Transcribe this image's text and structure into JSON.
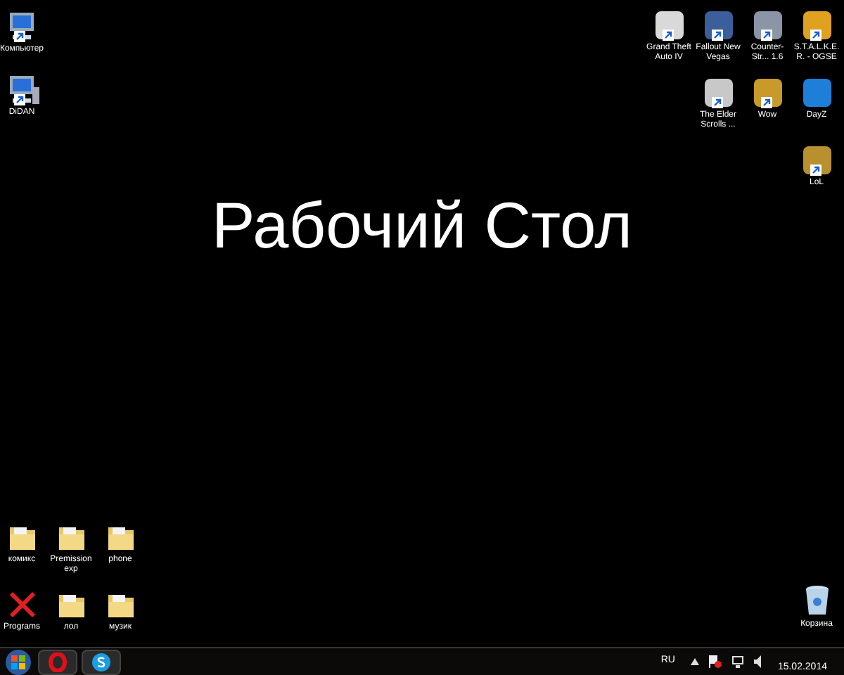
{
  "heading": "Рабочий Стол",
  "top_left": [
    {
      "label": "Компьютер",
      "kind": "computer",
      "shortcut": true
    },
    {
      "label": "DiDAN",
      "kind": "network_computer",
      "shortcut": true
    }
  ],
  "top_right_rows": [
    [
      {
        "label": "Grand Theft Auto IV",
        "kind": "app",
        "shortcut": true,
        "color": "#d9d9d9"
      },
      {
        "label": "Fallout New Vegas",
        "kind": "app",
        "shortcut": true,
        "color": "#3a5f9a"
      },
      {
        "label": "Counter-Str... 1.6",
        "kind": "app",
        "shortcut": true,
        "color": "#8a95a5"
      },
      {
        "label": "S.T.A.L.K.E.R. - OGSE",
        "kind": "app",
        "shortcut": true,
        "color": "#e0a020"
      }
    ],
    [
      {
        "label": "The Elder Scrolls ...",
        "kind": "app",
        "shortcut": true,
        "color": "#c8c8c8"
      },
      {
        "label": "Wow",
        "kind": "app",
        "shortcut": true,
        "color": "#c89a2a"
      },
      {
        "label": "DayZ",
        "kind": "app",
        "shortcut": false,
        "color": "#1e7fd8"
      }
    ],
    [
      {
        "label": "LoL",
        "kind": "app",
        "shortcut": true,
        "color": "#b8902e"
      }
    ]
  ],
  "bottom_left_rows": [
    [
      {
        "label": "комикс",
        "kind": "folder",
        "shortcut": false
      },
      {
        "label": "Premission exp",
        "kind": "folder",
        "shortcut": false
      },
      {
        "label": "phone",
        "kind": "folder",
        "shortcut": false
      }
    ],
    [
      {
        "label": "Programs",
        "kind": "cross",
        "shortcut": false
      },
      {
        "label": "лол",
        "kind": "folder",
        "shortcut": false
      },
      {
        "label": "музик",
        "kind": "folder",
        "shortcut": false
      }
    ]
  ],
  "bottom_right": [
    {
      "label": "Корзина",
      "kind": "trash",
      "shortcut": false
    }
  ],
  "taskbar": {
    "pinned": [
      {
        "kind": "opera"
      },
      {
        "kind": "skype"
      }
    ],
    "language": "RU",
    "date": "15.02.2014"
  }
}
